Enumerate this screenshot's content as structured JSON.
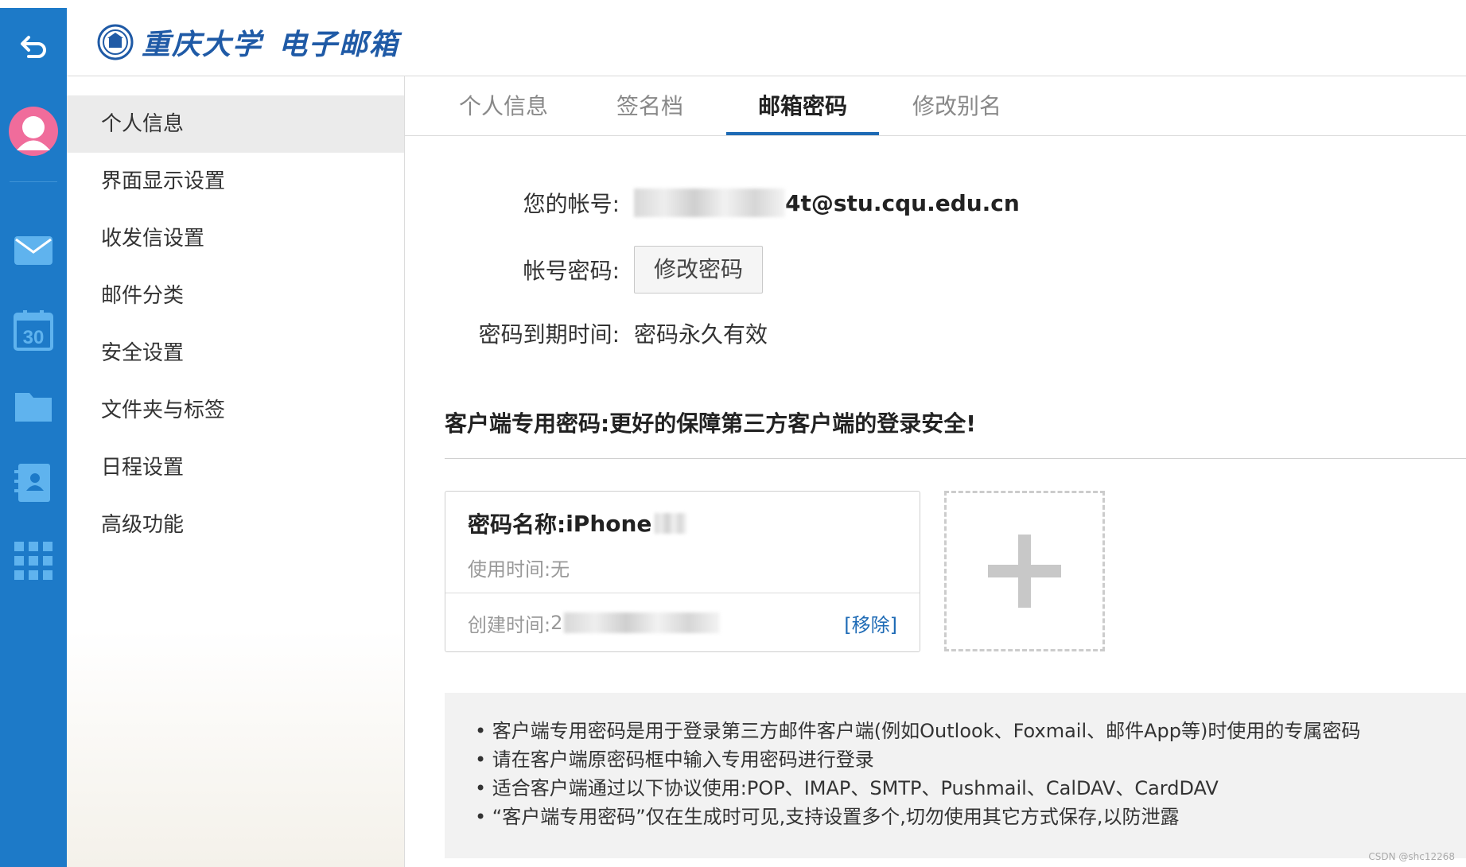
{
  "header": {
    "brand_name": "重庆大学",
    "brand_sub": "电子邮箱"
  },
  "rail": {
    "icons": [
      "back-icon",
      "avatar",
      "mail-icon",
      "calendar-icon",
      "folder-icon",
      "contacts-icon",
      "apps-grid-icon"
    ],
    "calendar_day": "30",
    "accent": "#1d7ac8"
  },
  "menu": {
    "items": [
      "个人信息",
      "界面显示设置",
      "收发信设置",
      "邮件分类",
      "安全设置",
      "文件夹与标签",
      "日程设置",
      "高级功能"
    ],
    "active": "个人信息"
  },
  "tabs": {
    "items": [
      "个人信息",
      "签名档",
      "邮箱密码",
      "修改别名"
    ],
    "active": "邮箱密码"
  },
  "account": {
    "account_label": "您的帐号:",
    "account_value_suffix": "4t@stu.cqu.edu.cn",
    "password_label": "帐号密码:",
    "change_password_button": "修改密码",
    "expiry_label": "密码到期时间:",
    "expiry_value": "密码永久有效"
  },
  "client_password": {
    "section_title": "客户端专用密码:更好的保障第三方客户端的登录安全!",
    "card": {
      "name_label": "密码名称:",
      "name_value": "iPhone",
      "used_label": "使用时间:",
      "used_value": "无",
      "created_label": "创建时间:",
      "created_value_prefix": "2",
      "created_value_tail": "2024-01-10 21:22",
      "remove_link": "[移除]"
    },
    "add_button_symbol": "+"
  },
  "info": {
    "lines": [
      "• 客户端专用密码是用于登录第三方邮件客户端(例如Outlook、Foxmail、邮件App等)时使用的专属密码",
      "• 请在客户端原密码框中输入专用密码进行登录",
      "• 适合客户端通过以下协议使用:POP、IMAP、SMTP、Pushmail、CalDAV、CardDAV",
      "• “客户端专用密码”仅在生成时可见,支持设置多个,切勿使用其它方式保存,以防泄露"
    ]
  },
  "watermark": "CSDN @shc12268",
  "colors": {
    "primary": "#1d6ab5",
    "rail": "#1d7ac8",
    "avatar": "#f06c9b"
  }
}
